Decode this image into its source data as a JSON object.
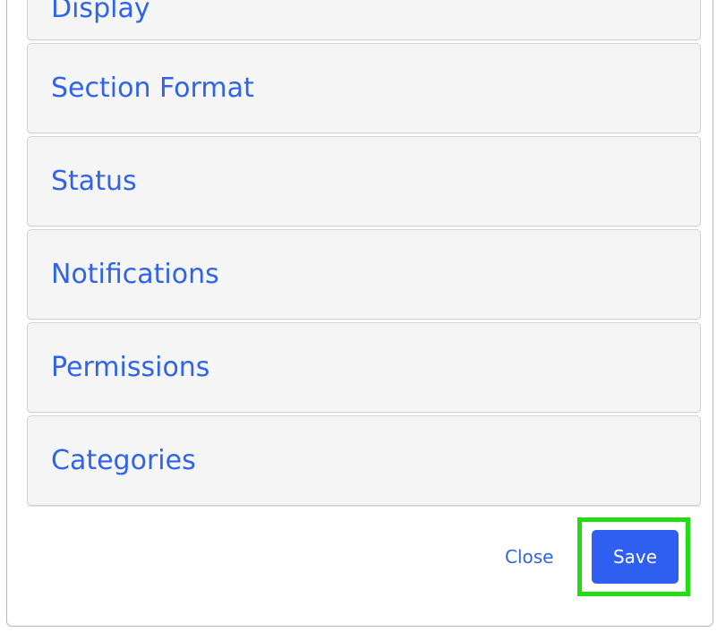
{
  "panels": [
    {
      "label": "Display"
    },
    {
      "label": "Section Format"
    },
    {
      "label": "Status"
    },
    {
      "label": "Notifications"
    },
    {
      "label": "Permissions"
    },
    {
      "label": "Categories"
    }
  ],
  "footer": {
    "close_label": "Close",
    "save_label": "Save"
  },
  "colors": {
    "link": "#2f64e8",
    "primary_button": "#2f5ff0",
    "highlight": "#22dd11",
    "panel_background": "#f5f5f5"
  }
}
